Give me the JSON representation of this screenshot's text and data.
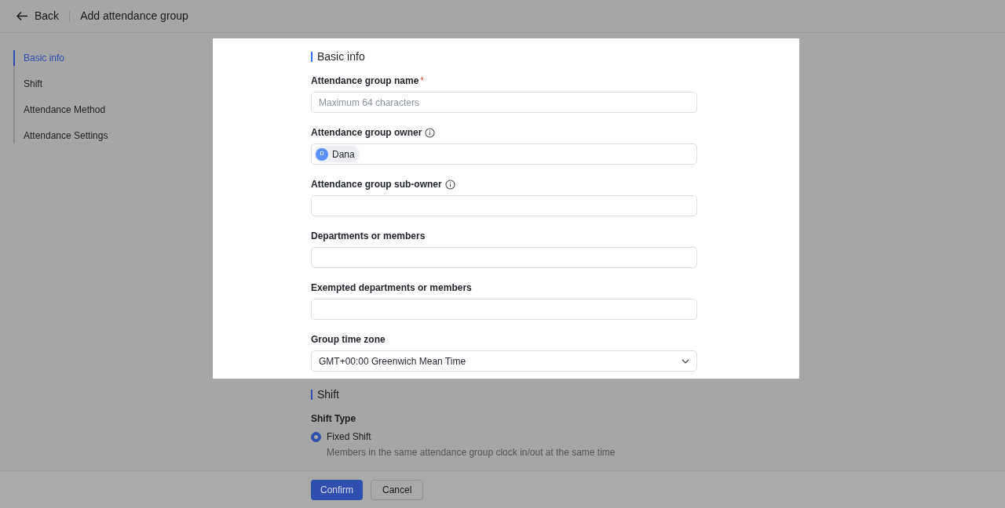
{
  "header": {
    "back_label": "Back",
    "title": "Add attendance group"
  },
  "sidebar": {
    "items": [
      {
        "label": "Basic info",
        "selected": true
      },
      {
        "label": "Shift",
        "selected": false
      },
      {
        "label": "Attendance Method",
        "selected": false
      },
      {
        "label": "Attendance Settings",
        "selected": false
      }
    ]
  },
  "basic_info": {
    "title": "Basic info",
    "fields": [
      {
        "kind": "text",
        "label": "Attendance group name",
        "required_mark": "*",
        "info": false,
        "placeholder": "Maximum 64 characters"
      },
      {
        "kind": "person",
        "label": "Attendance group owner",
        "info": true,
        "person": {
          "initial": "D",
          "name": "Dana"
        }
      },
      {
        "kind": "text",
        "label": "Attendance group sub-owner",
        "info": true
      },
      {
        "kind": "text",
        "label": "Departments or members",
        "info": false
      },
      {
        "kind": "text",
        "label": "Exempted departments or members",
        "info": false
      },
      {
        "kind": "select",
        "label": "Group time zone",
        "info": false,
        "value": "GMT+00:00 Greenwich Mean Time"
      }
    ]
  },
  "shift": {
    "title": "Shift",
    "field_label": "Shift Type",
    "options": [
      {
        "label": "Fixed Shift",
        "description": "Members in the same attendance group clock in/out at the same time",
        "selected": true
      }
    ]
  },
  "footer": {
    "buttons": [
      {
        "label": "Confirm",
        "kind": "primary"
      },
      {
        "label": "Cancel",
        "kind": "secondary"
      }
    ]
  }
}
